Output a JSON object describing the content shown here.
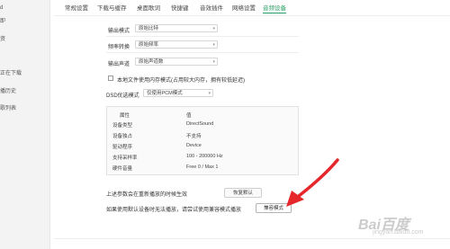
{
  "sidebar": {
    "items": [
      {
        "label": "d"
      },
      {
        "label": "即"
      },
      {
        "label": "资"
      },
      {
        "label": "正在下载"
      },
      {
        "label": "播历史"
      },
      {
        "label": "歌列表"
      }
    ]
  },
  "tabs": [
    {
      "label": "常规设置",
      "active": false
    },
    {
      "label": "下载与缓存",
      "active": false
    },
    {
      "label": "桌面歌词",
      "active": false
    },
    {
      "label": "快捷键",
      "active": false
    },
    {
      "label": "音效插件",
      "active": false
    },
    {
      "label": "网络设置",
      "active": false
    },
    {
      "label": "音频设备",
      "active": true
    }
  ],
  "output_mode": {
    "label": "输出模式",
    "value": "原始比特"
  },
  "sample_rate_conversion": {
    "label": "频率转换",
    "value": "原始频率"
  },
  "output_channel": {
    "label": "输出声道",
    "value": "原始声道数"
  },
  "memory_option": {
    "label": "本地文件使用内存模式(占用较大内存，拥有较低延迟)",
    "checked": false
  },
  "dsd": {
    "label": "DSD优选模式",
    "value": "仅使用PCM模式"
  },
  "device_table": {
    "headers": [
      "属性",
      "值"
    ],
    "rows": [
      [
        "设备类型",
        "DirectSound"
      ],
      [
        "设备独占",
        "不支持"
      ],
      [
        "驱动程序",
        "Device"
      ],
      [
        "支持采样率",
        "100 - 200000 Hz"
      ],
      [
        "硬件音量",
        "Free 0 / Max 1"
      ]
    ]
  },
  "restart_note": "上述参数会在重新播放的时候生效",
  "restore_default_label": "恢复默认",
  "compat_note": "如果使用默认设备时无法播放，请尝试使用兼容模式播放",
  "compat_mode_label": "兼容模式",
  "watermark": {
    "brand": "Bai百度",
    "sub": "jingyan.baidu.com"
  },
  "colors": {
    "accent": "#2a9f63",
    "arrow": "#e5262b"
  }
}
